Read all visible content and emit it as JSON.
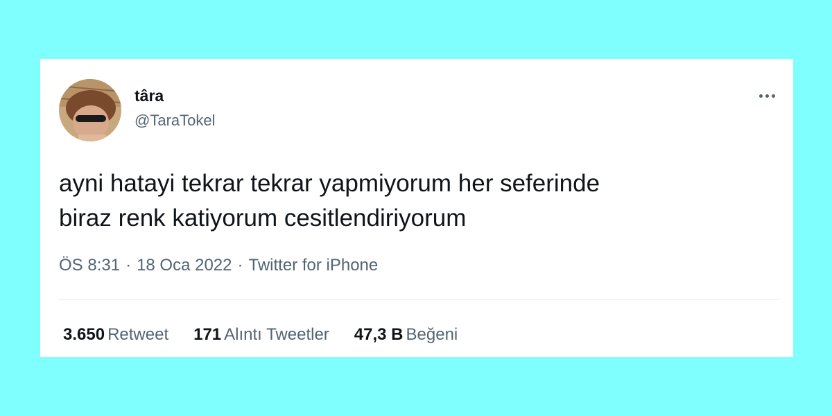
{
  "tweet": {
    "author": {
      "display_name": "târa",
      "handle": "@TaraTokel"
    },
    "text_lines": [
      "ayni hatayi tekrar tekrar yapmiyorum her seferinde",
      "biraz renk katiyorum cesitlendiriyorum"
    ],
    "meta": {
      "time": "ÖS 8:31",
      "date": "18 Oca 2022",
      "source": "Twitter for iPhone",
      "separator": "·"
    },
    "stats": {
      "retweets": {
        "value": "3.650",
        "label": "Retweet"
      },
      "quotes": {
        "value": "171",
        "label": "Alıntı Tweetler"
      },
      "likes": {
        "value": "47,3 B",
        "label": "Beğeni"
      }
    }
  },
  "icons": {
    "more": "more-horizontal-icon"
  },
  "colors": {
    "page_background": "#80ffff",
    "card_background": "#ffffff",
    "primary_text": "#0f1419",
    "secondary_text": "#536471",
    "divider": "#e1e8ed"
  }
}
